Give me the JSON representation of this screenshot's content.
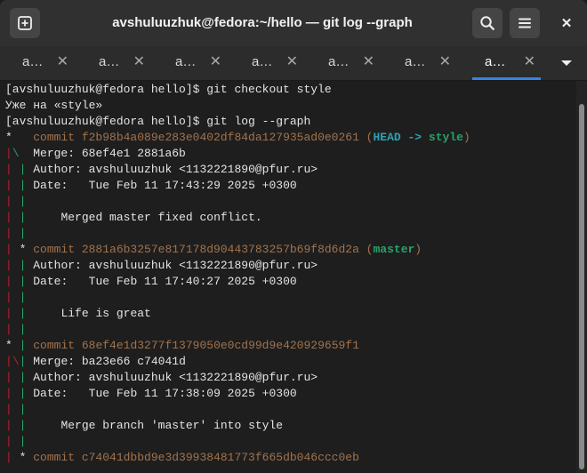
{
  "window": {
    "title": "avshuluuzhuk@fedora:~/hello — git log --graph"
  },
  "header": {
    "new_tab_icon": "plus-square-icon",
    "search_icon": "search-icon",
    "menu_icon": "hamburger-menu-icon",
    "close_icon": "close-icon",
    "close_glyph": "✕"
  },
  "tabs": [
    {
      "label": "a…",
      "close": "✕",
      "active": false
    },
    {
      "label": "a…",
      "close": "✕",
      "active": false
    },
    {
      "label": "a…",
      "close": "✕",
      "active": false
    },
    {
      "label": "a…",
      "close": "✕",
      "active": false
    },
    {
      "label": "a…",
      "close": "✕",
      "active": false
    },
    {
      "label": "a…",
      "close": "✕",
      "active": false
    },
    {
      "label": "a…",
      "close": "✕",
      "active": true
    }
  ],
  "tab_menu_icon": "chevron-down-icon",
  "colors": {
    "accent": "#3584e4",
    "graph_red": "#c01c28",
    "graph_green": "#26a269",
    "commit_hash": "#a2734c",
    "head_ref": "#2aa1b3"
  },
  "scroll_fraction": 0.95,
  "terminal_lines": [
    [
      {
        "t": "[avshuluuzhuk@fedora hello]$ git checkout style"
      }
    ],
    [
      {
        "t": "Уже на «style»"
      }
    ],
    [
      {
        "t": "[avshuluuzhuk@fedora hello]$ git log --graph"
      }
    ],
    [
      {
        "t": "*   "
      },
      {
        "t": "commit f2b98b4a089e283e0402df84da127935ad0e0261 (",
        "c": "yellow"
      },
      {
        "t": "HEAD -> ",
        "c": "cyan",
        "b": true
      },
      {
        "t": "style",
        "c": "green",
        "b": true
      },
      {
        "t": ")",
        "c": "yellow"
      }
    ],
    [
      {
        "t": "|",
        "c": "red"
      },
      {
        "t": "\\",
        "c": "green"
      },
      {
        "t": "  Merge: 68ef4e1 2881a6b"
      }
    ],
    [
      {
        "t": "|",
        "c": "red"
      },
      {
        "t": " "
      },
      {
        "t": "|",
        "c": "green"
      },
      {
        "t": " Author: avshuluuzhuk <1132221890@pfur.ru>"
      }
    ],
    [
      {
        "t": "|",
        "c": "red"
      },
      {
        "t": " "
      },
      {
        "t": "|",
        "c": "green"
      },
      {
        "t": " Date:   Tue Feb 11 17:43:29 2025 +0300"
      }
    ],
    [
      {
        "t": "|",
        "c": "red"
      },
      {
        "t": " "
      },
      {
        "t": "|",
        "c": "green"
      }
    ],
    [
      {
        "t": "|",
        "c": "red"
      },
      {
        "t": " "
      },
      {
        "t": "|",
        "c": "green"
      },
      {
        "t": "     Merged master fixed conflict."
      }
    ],
    [
      {
        "t": "|",
        "c": "red"
      },
      {
        "t": " "
      },
      {
        "t": "|",
        "c": "green"
      }
    ],
    [
      {
        "t": "|",
        "c": "red"
      },
      {
        "t": " * "
      },
      {
        "t": "commit 2881a6b3257e817178d90443783257b69f8d6d2a (",
        "c": "yellow"
      },
      {
        "t": "master",
        "c": "green",
        "b": true
      },
      {
        "t": ")",
        "c": "yellow"
      }
    ],
    [
      {
        "t": "|",
        "c": "red"
      },
      {
        "t": " "
      },
      {
        "t": "|",
        "c": "green"
      },
      {
        "t": " Author: avshuluuzhuk <1132221890@pfur.ru>"
      }
    ],
    [
      {
        "t": "|",
        "c": "red"
      },
      {
        "t": " "
      },
      {
        "t": "|",
        "c": "green"
      },
      {
        "t": " Date:   Tue Feb 11 17:40:27 2025 +0300"
      }
    ],
    [
      {
        "t": "|",
        "c": "red"
      },
      {
        "t": " "
      },
      {
        "t": "|",
        "c": "green"
      }
    ],
    [
      {
        "t": "|",
        "c": "red"
      },
      {
        "t": " "
      },
      {
        "t": "|",
        "c": "green"
      },
      {
        "t": "     Life is great"
      }
    ],
    [
      {
        "t": "|",
        "c": "red"
      },
      {
        "t": " "
      },
      {
        "t": "|",
        "c": "green"
      }
    ],
    [
      {
        "t": "* "
      },
      {
        "t": "|",
        "c": "green"
      },
      {
        "t": " "
      },
      {
        "t": "commit 68ef4e1d3277f1379050e0cd99d9e420929659f1",
        "c": "yellow"
      }
    ],
    [
      {
        "t": "|",
        "c": "red"
      },
      {
        "t": "\\",
        "c": "red"
      },
      {
        "t": "|",
        "c": "green"
      },
      {
        "t": " Merge: ba23e66 c74041d"
      }
    ],
    [
      {
        "t": "|",
        "c": "red"
      },
      {
        "t": " "
      },
      {
        "t": "|",
        "c": "green"
      },
      {
        "t": " Author: avshuluuzhuk <1132221890@pfur.ru>"
      }
    ],
    [
      {
        "t": "|",
        "c": "red"
      },
      {
        "t": " "
      },
      {
        "t": "|",
        "c": "green"
      },
      {
        "t": " Date:   Tue Feb 11 17:38:09 2025 +0300"
      }
    ],
    [
      {
        "t": "|",
        "c": "red"
      },
      {
        "t": " "
      },
      {
        "t": "|",
        "c": "green"
      }
    ],
    [
      {
        "t": "|",
        "c": "red"
      },
      {
        "t": " "
      },
      {
        "t": "|",
        "c": "green"
      },
      {
        "t": "     Merge branch 'master' into style"
      }
    ],
    [
      {
        "t": "|",
        "c": "red"
      },
      {
        "t": " "
      },
      {
        "t": "|",
        "c": "green"
      }
    ],
    [
      {
        "t": "|",
        "c": "red"
      },
      {
        "t": " * "
      },
      {
        "t": "commit c74041dbbd9e3d39938481773f665db046ccc0eb",
        "c": "yellow"
      }
    ]
  ]
}
